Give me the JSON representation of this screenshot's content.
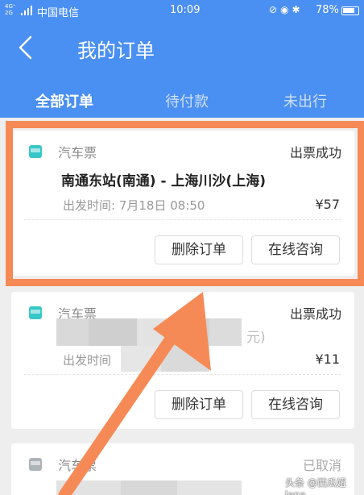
{
  "status_bar": {
    "network": "4G⁺ 2G",
    "carrier": "中国电信",
    "time": "10:09",
    "battery": "78%"
  },
  "header": {
    "title": "我的订单"
  },
  "tabs": [
    {
      "label": "全部订单",
      "active": true
    },
    {
      "label": "待付款",
      "active": false
    },
    {
      "label": "未出行",
      "active": false
    }
  ],
  "orders": [
    {
      "type": "汽车票",
      "status": "出票成功",
      "route": "南通东站(南通) - 上海川沙(上海)",
      "depart": "出发时间: 7月18日 08:50",
      "price": "¥57",
      "delete_label": "删除订单",
      "consult_label": "在线咨询"
    },
    {
      "type": "汽车票",
      "status": "出票成功",
      "route": "元)",
      "depart": "出发时间",
      "price": "¥11",
      "delete_label": "删除订单",
      "consult_label": "在线咨询"
    },
    {
      "type": "汽车票",
      "status": "已取消"
    }
  ],
  "watermark": "头条 @西瓜妞lena",
  "colors": {
    "header_blue": "#4a8ff2",
    "highlight_orange": "#f68a56",
    "bus_icon_teal": "#37c7c9"
  }
}
